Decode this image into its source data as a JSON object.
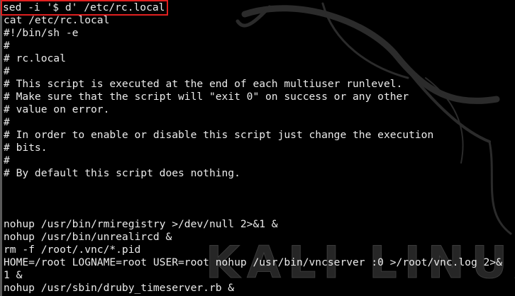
{
  "terminal": {
    "highlight_color": "#e0201f",
    "text_color": "#ebebeb",
    "background_color": "#000000",
    "watermark_text": "KALI LINUX",
    "command": "sed -i '$ d' /etc/rc.local",
    "lines": [
      "cat /etc/rc.local",
      "#!/bin/sh -e",
      "#",
      "# rc.local",
      "#",
      "# This script is executed at the end of each multiuser runlevel.",
      "# Make sure that the script will \"exit 0\" on success or any other",
      "# value on error.",
      "#",
      "# In order to enable or disable this script just change the execution",
      "# bits.",
      "#",
      "# By default this script does nothing.",
      "",
      "",
      "",
      "nohup /usr/bin/rmiregistry >/dev/null 2>&1 &",
      "nohup /usr/bin/unrealircd &",
      "rm -f /root/.vnc/*.pid",
      "HOME=/root LOGNAME=root USER=root nohup /usr/bin/vncserver :0 >/root/vnc.log 2>&",
      "1 &",
      "nohup /usr/sbin/druby_timeserver.rb &"
    ]
  }
}
